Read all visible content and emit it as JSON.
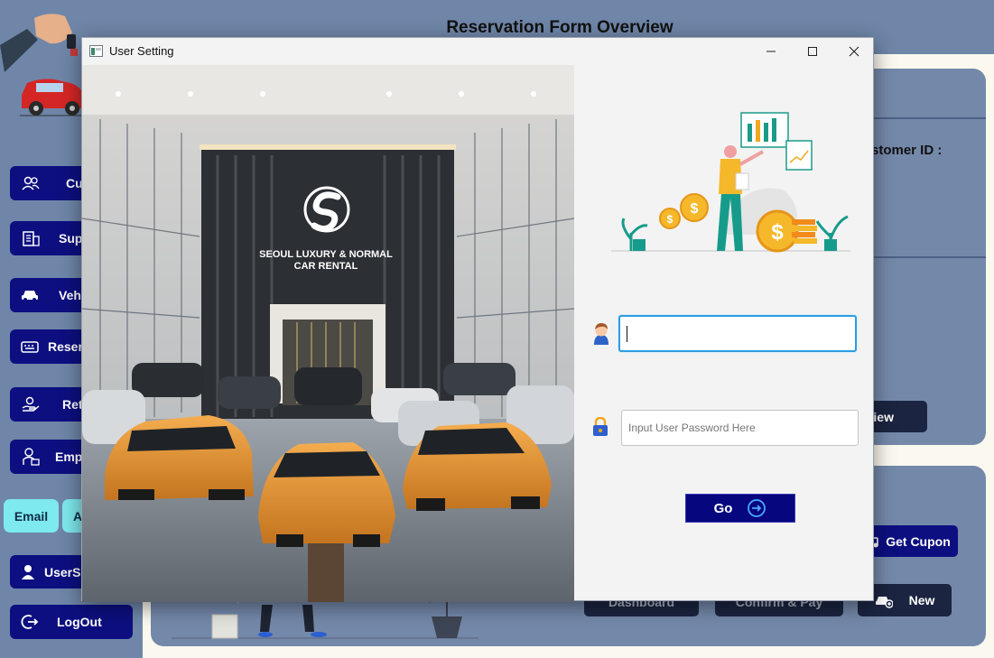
{
  "page": {
    "title": "Reservation Form Overview",
    "customer_id_label": "stomer ID :"
  },
  "sidebar": {
    "items": [
      {
        "label": "Cust",
        "icon": "users-icon"
      },
      {
        "label": "Sup",
        "icon": "building-icon"
      },
      {
        "label": "Veh",
        "icon": "car-icon"
      },
      {
        "label": "Reser",
        "icon": "keyboard-icon"
      },
      {
        "label": "Ret",
        "icon": "hand-return-icon"
      },
      {
        "label": "Empl",
        "icon": "employee-icon"
      }
    ],
    "email_label": "Email",
    "second_label": "A",
    "usersetting_label": "UserSe",
    "logout_label": "LogOut"
  },
  "main": {
    "view_button": "iew",
    "get_coupon_button": "Get Cupon",
    "dashboard_button": "Dashboard",
    "confirm_pay_button": "Confirm & Pay",
    "new_button": "New"
  },
  "dialog": {
    "window_title": "User Setting",
    "hero_sign_line1": "SEOUL LUXURY & NORMAL",
    "hero_sign_line2": "CAR RENTAL",
    "username_value": "",
    "password_placeholder": "Input User Password Here",
    "go_button": "Go"
  },
  "colors": {
    "navy": "#0d0f80",
    "cyan": "#7ee9ee",
    "panel": "#7489aa",
    "go_button": "#06067e",
    "focus_border": "#2f9be0"
  }
}
